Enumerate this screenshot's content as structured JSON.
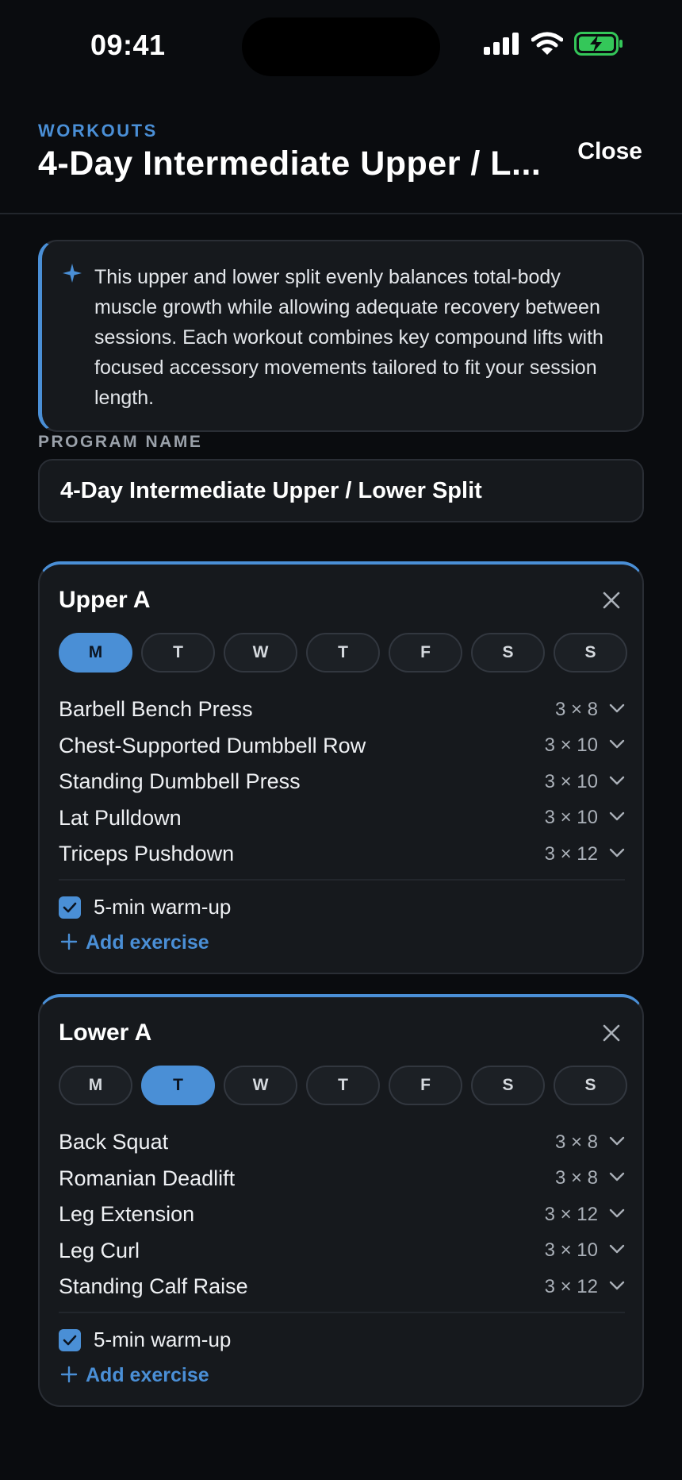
{
  "status_bar": {
    "time": "09:41"
  },
  "header": {
    "eyebrow": "WORKOUTS",
    "title": "4-Day Intermediate Upper / L...",
    "close_label": "Close"
  },
  "info": {
    "text": "This upper and lower split evenly balances total-body muscle growth while allowing adequate recovery between sessions. Each workout combines key compound lifts with focused accessory movements tailored to fit your session length."
  },
  "program": {
    "label": "PROGRAM NAME",
    "value": "4-Day Intermediate Upper / Lower Split"
  },
  "workouts": [
    {
      "title": "Upper A",
      "days": [
        "M",
        "T",
        "W",
        "T",
        "F",
        "S",
        "S"
      ],
      "active_day": 0,
      "exercises": [
        {
          "name": "Barbell Bench Press",
          "sets": "3 × 8"
        },
        {
          "name": "Chest-Supported Dumbbell Row",
          "sets": "3 × 10"
        },
        {
          "name": "Standing Dumbbell Press",
          "sets": "3 × 10"
        },
        {
          "name": "Lat Pulldown",
          "sets": "3 × 10"
        },
        {
          "name": "Triceps Pushdown",
          "sets": "3 × 12"
        }
      ],
      "warmup_label": "5-min warm-up",
      "warmup_checked": true,
      "add_label": "Add exercise"
    },
    {
      "title": "Lower A",
      "days": [
        "M",
        "T",
        "W",
        "T",
        "F",
        "S",
        "S"
      ],
      "active_day": 1,
      "exercises": [
        {
          "name": "Back Squat",
          "sets": "3 × 8"
        },
        {
          "name": "Romanian Deadlift",
          "sets": "3 × 8"
        },
        {
          "name": "Leg Extension",
          "sets": "3 × 12"
        },
        {
          "name": "Leg Curl",
          "sets": "3 × 10"
        },
        {
          "name": "Standing Calf Raise",
          "sets": "3 × 12"
        }
      ],
      "warmup_label": "5-min warm-up",
      "warmup_checked": true,
      "add_label": "Add exercise"
    }
  ],
  "colors": {
    "accent": "#4a8fd6",
    "background": "#0a0c0f",
    "card": "#16191d",
    "battery": "#34c759"
  },
  "icons": [
    "signal-icon",
    "wifi-icon",
    "battery-icon",
    "sparkle-icon",
    "close-icon",
    "chevron-down-icon",
    "check-icon",
    "plus-icon"
  ]
}
